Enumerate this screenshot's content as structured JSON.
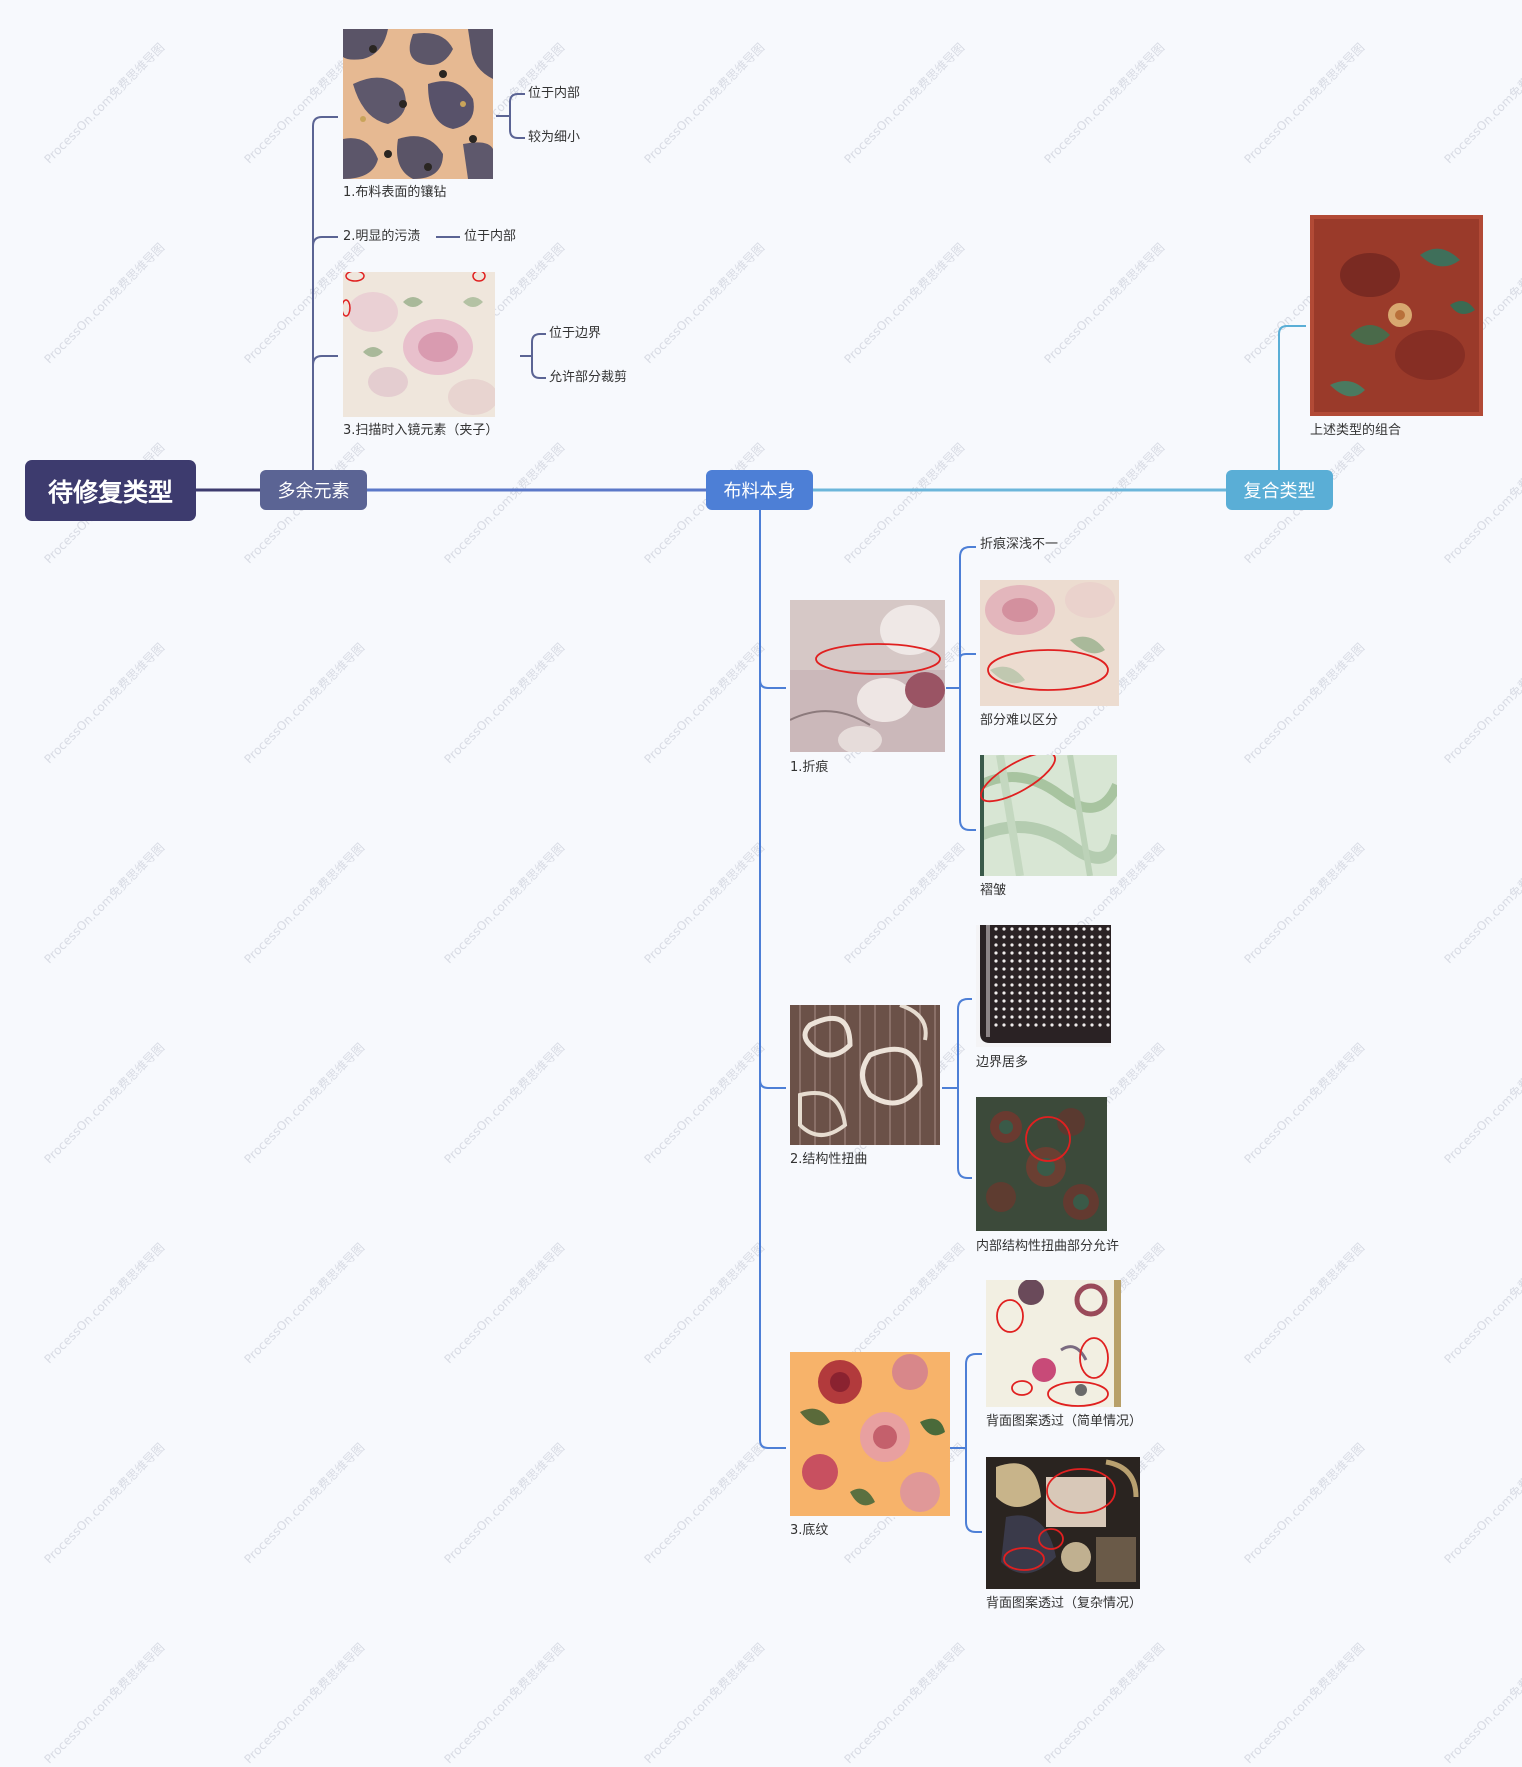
{
  "colors": {
    "background": "#f7f9fd",
    "root": "#3d3b6e",
    "branch_extra": "#5b6494",
    "branch_fabric": "#4d7fd6",
    "branch_composite": "#5aaed6",
    "mark_circle": "#e02020"
  },
  "root": {
    "label": "待修复类型"
  },
  "branches": {
    "extra": {
      "label": "多余元素",
      "items": [
        {
          "label": "1.布料表面的镶钻",
          "image": "leopard-fabric-with-studs",
          "notes": [
            "位于内部",
            "较为细小"
          ]
        },
        {
          "label": "2.明显的污渍",
          "notes": [
            "位于内部"
          ]
        },
        {
          "label": "3.扫描时入镜元素（夹子）",
          "image": "floral-fabric-with-clips",
          "notes": [
            "位于边界",
            "允许部分裁剪"
          ]
        }
      ]
    },
    "fabric": {
      "label": "布料本身",
      "items": [
        {
          "label": "1.折痕",
          "image": "floral-crease-fabric",
          "sub": [
            {
              "label": "折痕深浅不一"
            },
            {
              "label": "部分难以区分",
              "image": "pink-floral-crease"
            },
            {
              "label": "褶皱",
              "image": "green-wrinkled-fabric"
            }
          ]
        },
        {
          "label": "2.结构性扭曲",
          "image": "paisley-brown-fabric",
          "sub": [
            {
              "label": "边界居多",
              "image": "polka-dot-scarf"
            },
            {
              "label": "内部结构性扭曲部分允许",
              "image": "dark-pattern-fabric"
            }
          ]
        },
        {
          "label": "3.底纹",
          "image": "orange-peony-fabric",
          "sub": [
            {
              "label": "背面图案透过（简单情况）",
              "image": "cream-floral-fabric"
            },
            {
              "label": "背面图案透过（复杂情况）",
              "image": "dark-paisley-fabric"
            }
          ]
        }
      ]
    },
    "composite": {
      "label": "复合类型",
      "items": [
        {
          "label": "上述类型的组合",
          "image": "red-floral-scarf"
        }
      ]
    }
  },
  "watermark": "ProcessOn.com免费思维导图"
}
